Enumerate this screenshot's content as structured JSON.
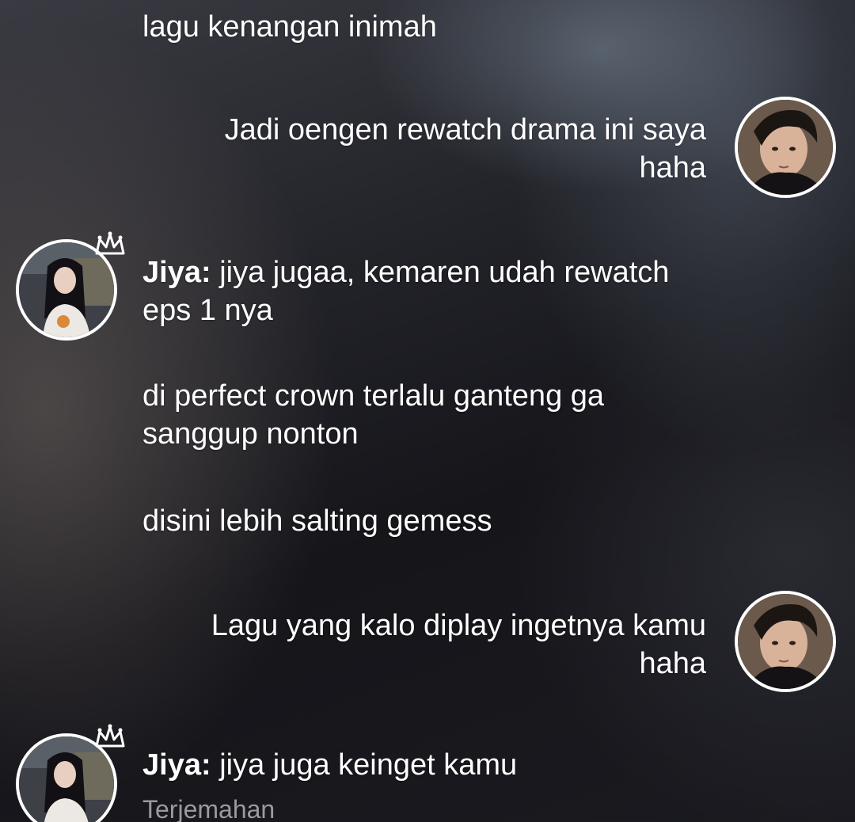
{
  "chat": {
    "messages": [
      {
        "text": "lagu kenangan inimah"
      },
      {
        "text": "Jadi oengen rewatch drama ini saya haha"
      },
      {
        "sender": "Jiya:",
        "text": "jiya jugaa, kemaren udah rewatch eps 1 nya"
      },
      {
        "text": "di perfect crown terlalu ganteng ga sanggup nonton"
      },
      {
        "text": "disini lebih salting gemess"
      },
      {
        "text": "Lagu yang kalo diplay ingetnya kamu haha"
      },
      {
        "sender": "Jiya:",
        "text": "jiya juga keinget kamu"
      }
    ],
    "translate_label": "Terjemahan"
  },
  "icons": {
    "crown": "crown-icon",
    "avatar_self": "avatar-photo",
    "avatar_jiya": "avatar-photo"
  }
}
